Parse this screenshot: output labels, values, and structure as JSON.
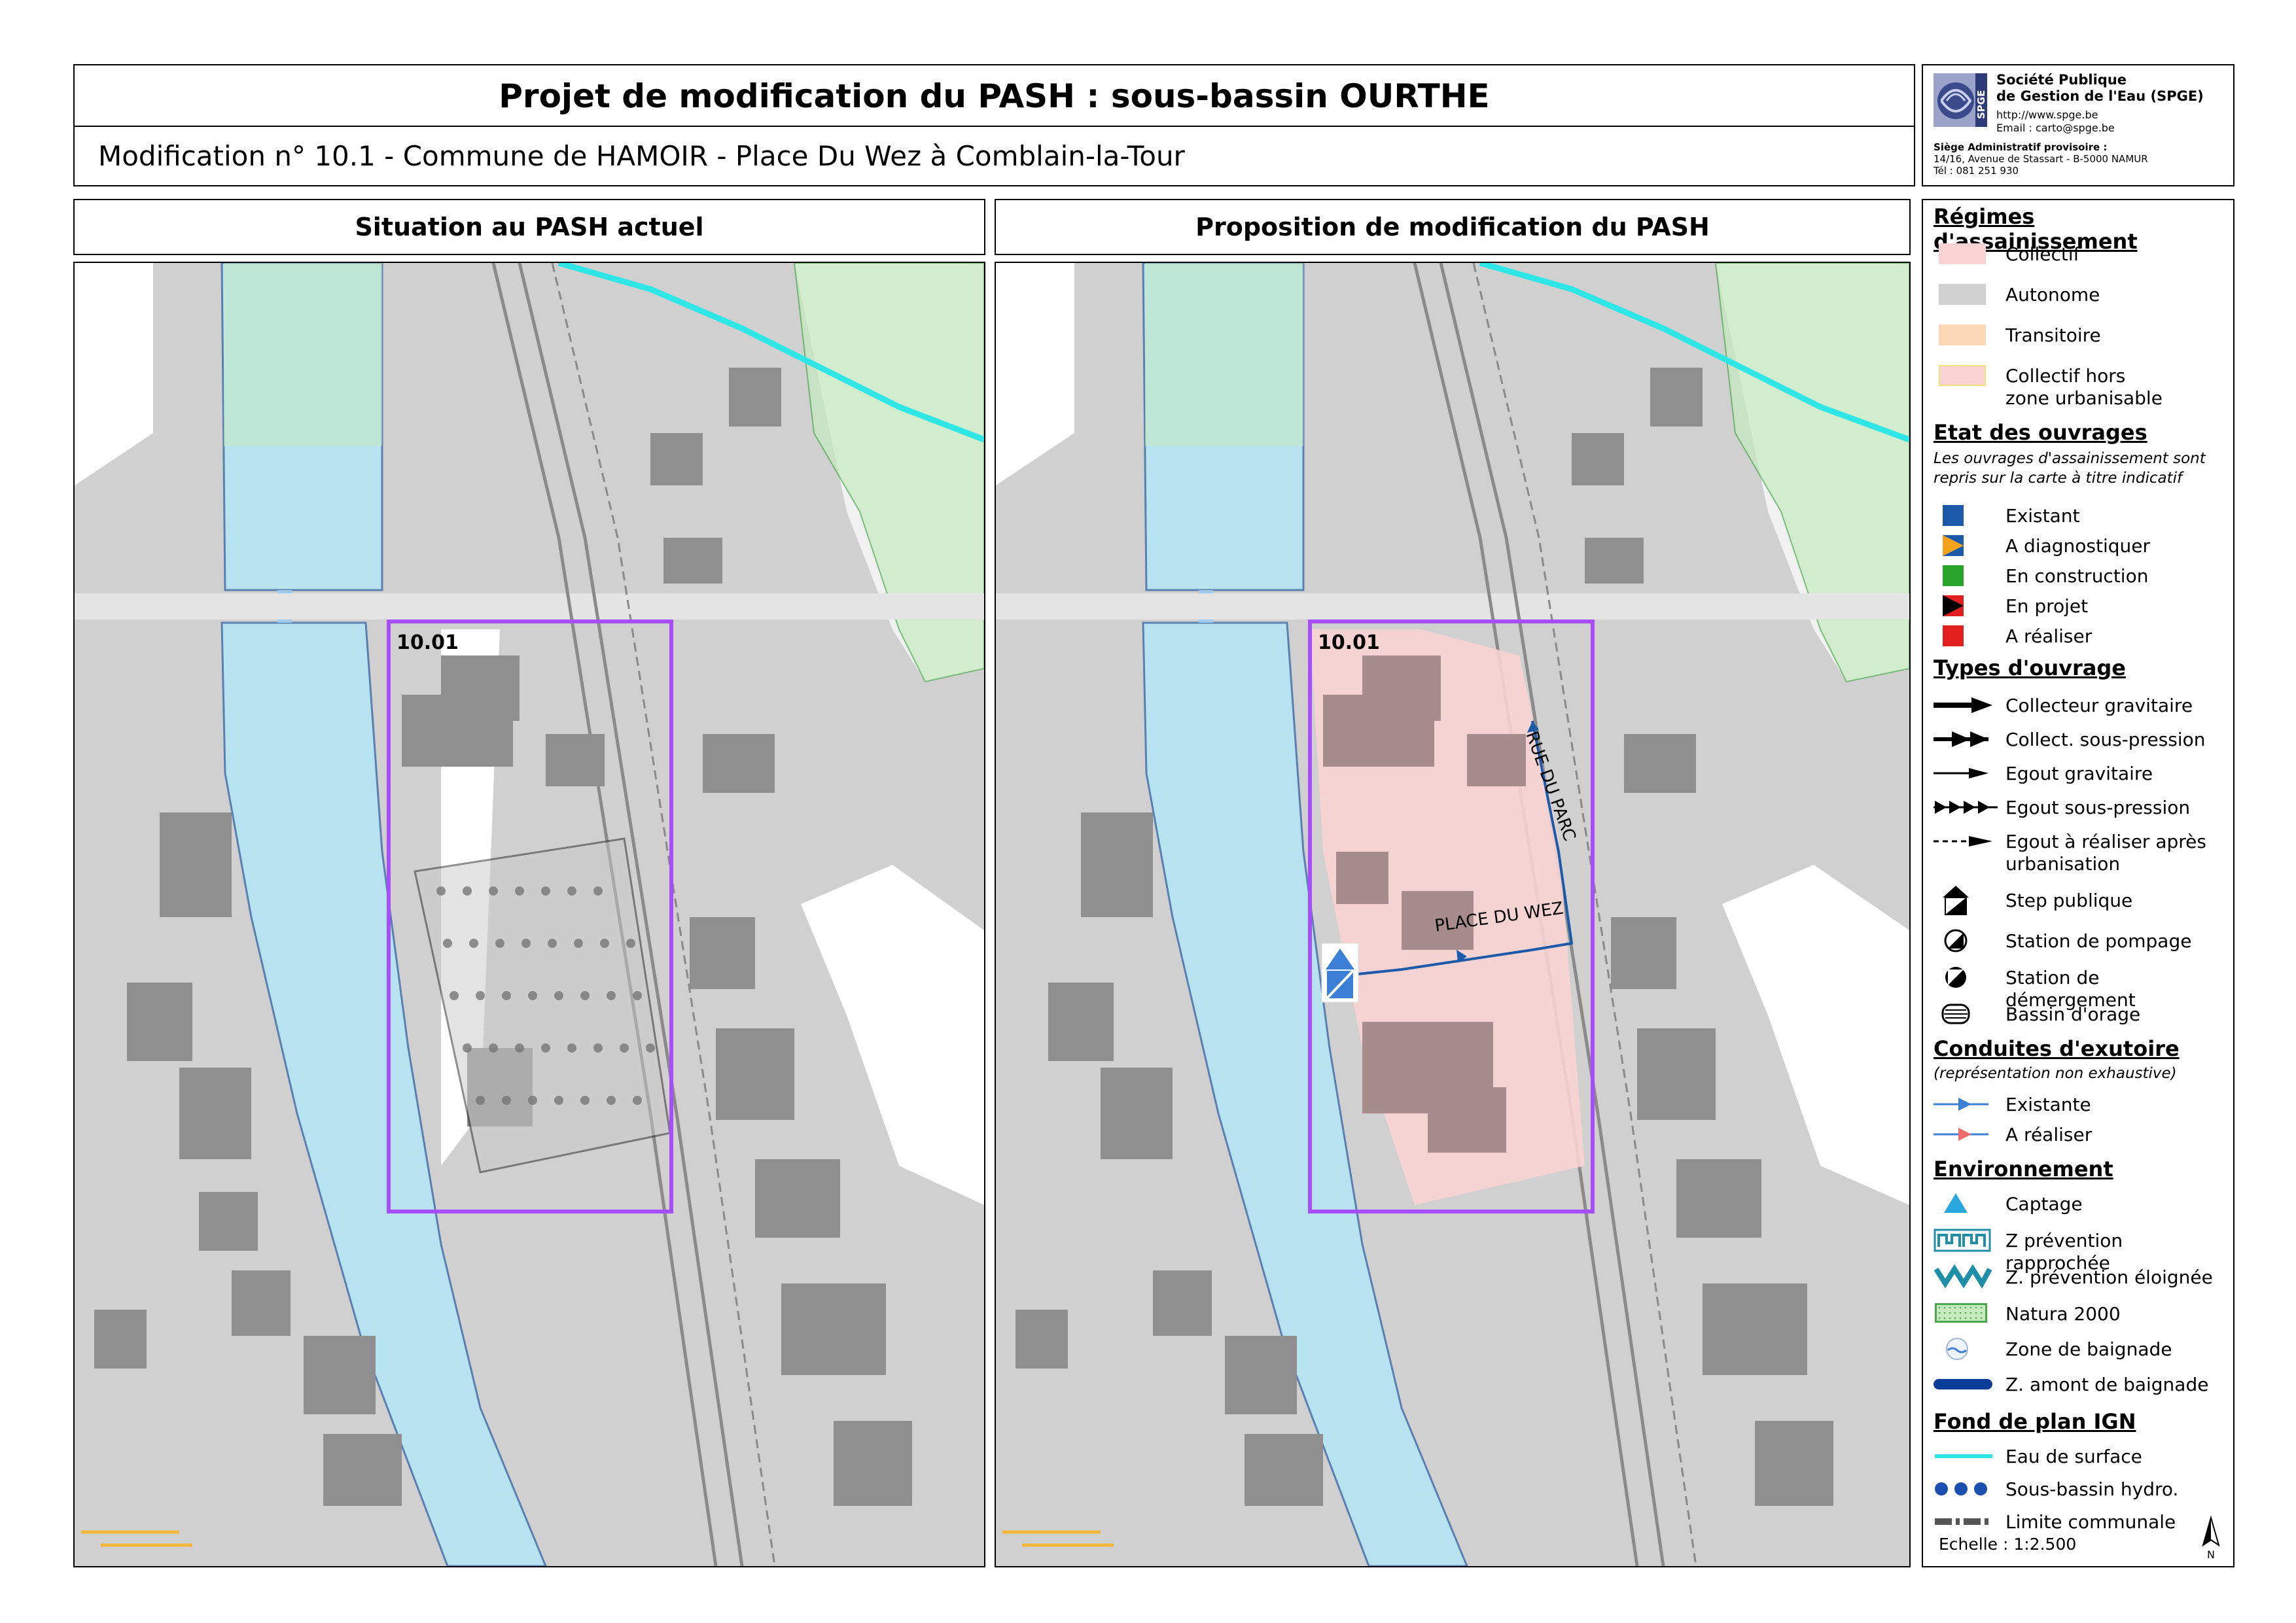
{
  "header": {
    "title": "Projet de modification du PASH : sous-bassin OURTHE",
    "subtitle": "Modification n° 10.1 - Commune de HAMOIR - Place Du Wez à Comblain-la-Tour"
  },
  "spge": {
    "logo_text": "SPGE",
    "name_line1": "Société Publique",
    "name_line2": "de Gestion de l'Eau (SPGE)",
    "website": "http://www.spge.be",
    "email": "Email : carto@spge.be",
    "seat_label": "Siège Administratif provisoire :",
    "address": "14/16, Avenue de Stassart - B-5000 NAMUR",
    "phone": "Tél : 081 251 930"
  },
  "panels": {
    "left_title": "Situation au PASH actuel",
    "right_title": "Proposition de modification du PASH",
    "zone_label": "10.01",
    "street_1": "RUE DU PARC",
    "street_2": "PLACE DU WEZ"
  },
  "legend": {
    "regimes": {
      "heading": "Régimes d'assainissement",
      "items": [
        "Collectif",
        "Autonome",
        "Transitoire",
        "Collectif hors",
        "zone urbanisable"
      ]
    },
    "etat": {
      "heading": "Etat des ouvrages",
      "note_line1": "Les ouvrages d'assainissement sont",
      "note_line2": "repris sur la carte à titre indicatif",
      "items": [
        "Existant",
        "A diagnostiquer",
        "En construction",
        "En projet",
        "A réaliser"
      ]
    },
    "types": {
      "heading": "Types d'ouvrage",
      "items": [
        "Collecteur gravitaire",
        "Collect. sous-pression",
        "Egout gravitaire",
        "Egout sous-pression",
        "Egout à réaliser après",
        "urbanisation",
        "Step publique",
        "Station de pompage",
        "Station de démergement",
        "Bassin d'orage"
      ]
    },
    "conduites": {
      "heading": "Conduites d'exutoire",
      "note": "(représentation non exhaustive)",
      "items": [
        "Existante",
        "A réaliser"
      ]
    },
    "environnement": {
      "heading": "Environnement",
      "items": [
        "Captage",
        "Z prévention rapprochée",
        "Z. prévention éloignée",
        "Natura 2000",
        "Zone de baignade",
        "Z. amont de baignade"
      ]
    },
    "fond": {
      "heading": "Fond de plan IGN",
      "items": [
        "Eau de surface",
        "Sous-bassin hydro.",
        "Limite communale"
      ]
    },
    "scale": "Echelle :  1:2.500",
    "north": "N"
  },
  "colors": {
    "collectif": "#f9d3d3",
    "autonome": "#d0d0d0",
    "transitoire": "#fbd7b5",
    "river": "#b7e3f1",
    "surface_water": "#2ee6e6",
    "zone_frame": "#a64dff",
    "natura": "#c6ebc0",
    "existant": "#1a5aa8",
    "en_construction": "#2aa52a",
    "a_realiser": "#e31e1e"
  }
}
